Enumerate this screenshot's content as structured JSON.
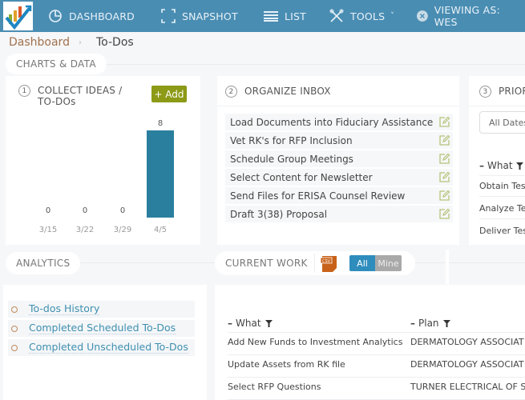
{
  "nav": {
    "items": [
      {
        "label": "DASHBOARD",
        "icon": "pie-chart-icon"
      },
      {
        "label": "SNAPSHOT",
        "icon": "frame-icon"
      },
      {
        "label": "LIST",
        "icon": "list-icon"
      },
      {
        "label": "TOOLS",
        "icon": "tools-icon",
        "dropdown": "˅"
      },
      {
        "label": "VIEWING AS: WES",
        "icon": "close-circle-icon"
      }
    ],
    "brand_color": "#4a8db3"
  },
  "breadcrumb": {
    "root": "Dashboard",
    "separator": "›",
    "current": "To-Dos"
  },
  "sections": {
    "charts": "CHARTS & DATA",
    "analytics": "ANALYTICS",
    "current_work": "CURRENT WORK"
  },
  "collect": {
    "number": "1",
    "title_line1": "COLLECT IDEAS /",
    "title_line2": "TO-DOs",
    "add_label": "+ Add"
  },
  "chart_data": {
    "type": "bar",
    "categories": [
      "3/15",
      "3/22",
      "3/29",
      "4/5"
    ],
    "values": [
      0,
      0,
      0,
      8
    ],
    "title": "",
    "xlabel": "",
    "ylabel": "",
    "ylim": [
      0,
      8
    ],
    "color": "#2a7f9e",
    "grid": false
  },
  "inbox": {
    "number": "2",
    "title": "ORGANIZE INBOX",
    "items": [
      "Load Documents into Fiduciary Assistance",
      "Vet RK's for RFP Inclusion",
      "Schedule Group Meetings",
      "Select Content for Newsletter",
      "Send Files for ERISA Counsel Review",
      "Draft 3(38) Proposal"
    ]
  },
  "prioritize": {
    "number": "3",
    "title": "PRIOR",
    "filter_value": "All Dates",
    "column": "What",
    "rows": [
      "Obtain Test",
      "Analyze Tes",
      "Deliver Test"
    ]
  },
  "analytics": {
    "items": [
      "To-dos History",
      "Completed Scheduled To-Dos",
      "Completed Unscheduled To-Dos"
    ]
  },
  "current_work": {
    "export_label": "CSV",
    "toggle": {
      "all": "All",
      "mine": "Mine",
      "selected": "All"
    },
    "columns": [
      "What",
      "Plan"
    ],
    "rows": [
      {
        "what": "Add New Funds to Investment Analytics",
        "plan": "DERMATOLOGY ASSOCIAT"
      },
      {
        "what": "Update Assets from RK file",
        "plan": "DERMATOLOGY ASSOCIAT"
      },
      {
        "what": "Select RFP Questions",
        "plan": "TURNER ELECTRICAL OF S"
      }
    ]
  }
}
